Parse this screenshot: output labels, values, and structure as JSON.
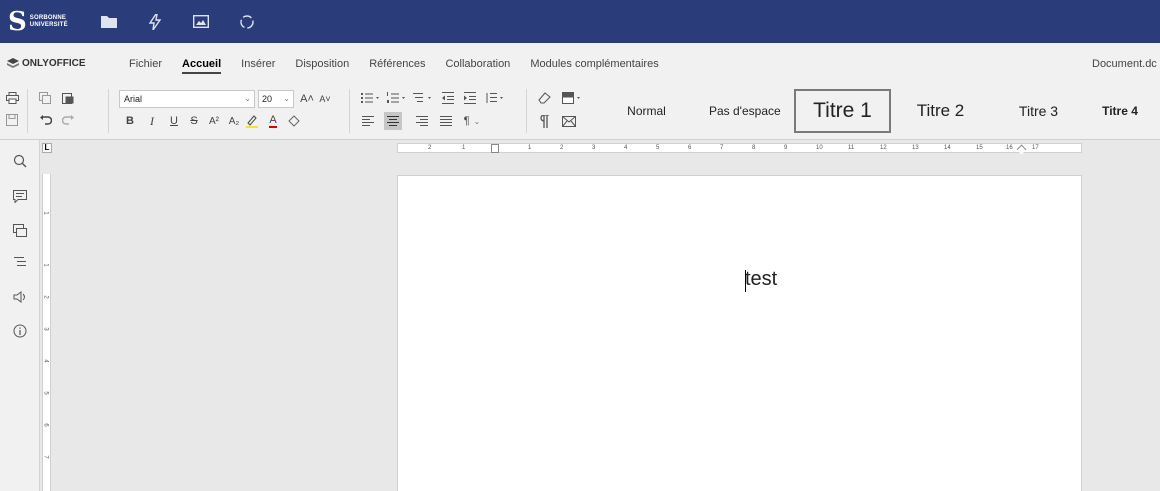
{
  "topbar": {
    "logo": {
      "initial": "S",
      "line1": "SORBONNE",
      "line2": "UNIVERSITÉ"
    },
    "icons": [
      "folder-icon",
      "bolt-icon",
      "image-icon",
      "recycle-icon"
    ],
    "background": "#2a3c7a"
  },
  "menubar": {
    "brand": "ONLYOFFICE",
    "tabs": [
      {
        "label": "Fichier",
        "active": false
      },
      {
        "label": "Accueil",
        "active": true
      },
      {
        "label": "Insérer",
        "active": false
      },
      {
        "label": "Disposition",
        "active": false
      },
      {
        "label": "Références",
        "active": false
      },
      {
        "label": "Collaboration",
        "active": false
      },
      {
        "label": "Modules complémentaires",
        "active": false
      }
    ],
    "document_name": "Document.dc"
  },
  "toolbar": {
    "font_name": "Arial",
    "font_size": "20",
    "bold": "B",
    "italic": "I",
    "underline": "U",
    "strike": "S",
    "superscript": "A²",
    "subscript": "A₂",
    "grow_font": "A˄",
    "shrink_font": "A˅",
    "font_color": "A",
    "pilcrow": "¶",
    "styles": [
      {
        "label": "Normal",
        "size": "12px",
        "bold": false
      },
      {
        "label": "Pas d'espace",
        "size": "12px",
        "bold": false
      },
      {
        "label": "Titre 1",
        "size": "21px",
        "bold": false
      },
      {
        "label": "Titre 2",
        "size": "17px",
        "bold": false
      },
      {
        "label": "Titre 3",
        "size": "14px",
        "bold": false
      },
      {
        "label": "Titre 4",
        "size": "12px",
        "bold": true
      }
    ],
    "selected_style": "Titre 1"
  },
  "left_panel": {
    "icons": [
      "search-icon",
      "comment-icon",
      "chat-icon",
      "navigation-icon",
      "feedback-icon",
      "info-icon"
    ]
  },
  "rulers": {
    "corner_label": "L",
    "horizontal_numbers": [
      "2",
      "1",
      "1",
      "2",
      "3",
      "4",
      "5",
      "6",
      "7",
      "8",
      "9",
      "10",
      "11",
      "12",
      "13",
      "14",
      "15",
      "16",
      "17"
    ],
    "vertical_numbers": [
      "1",
      "1",
      "2",
      "3",
      "4",
      "5",
      "6",
      "7"
    ]
  },
  "document": {
    "text": "test"
  }
}
